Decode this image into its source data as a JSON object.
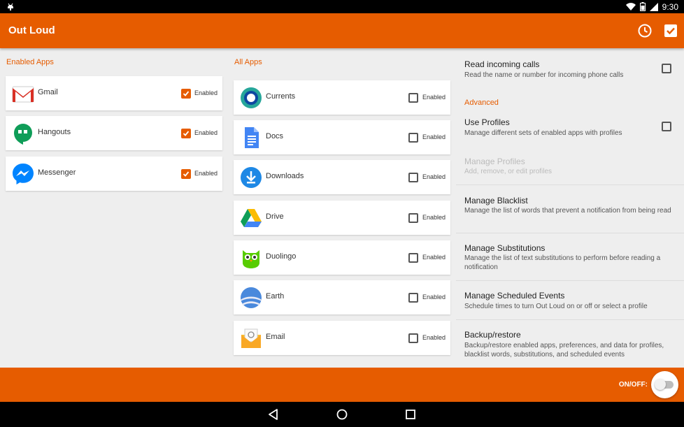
{
  "status_bar": {
    "time": "9:30"
  },
  "app_bar": {
    "title": "Out Loud"
  },
  "enabled_apps": {
    "header": "Enabled Apps",
    "items": [
      {
        "name": "Gmail",
        "enabled_label": "Enabled",
        "checked": true,
        "icon": "gmail-icon"
      },
      {
        "name": "Hangouts",
        "enabled_label": "Enabled",
        "checked": true,
        "icon": "hangouts-icon"
      },
      {
        "name": "Messenger",
        "enabled_label": "Enabled",
        "checked": true,
        "icon": "messenger-icon"
      }
    ]
  },
  "all_apps": {
    "header": "All Apps",
    "items": [
      {
        "name": "Currents",
        "enabled_label": "Enabled",
        "checked": false,
        "icon": "currents-icon"
      },
      {
        "name": "Docs",
        "enabled_label": "Enabled",
        "checked": false,
        "icon": "docs-icon"
      },
      {
        "name": "Downloads",
        "enabled_label": "Enabled",
        "checked": false,
        "icon": "downloads-icon"
      },
      {
        "name": "Drive",
        "enabled_label": "Enabled",
        "checked": false,
        "icon": "drive-icon"
      },
      {
        "name": "Duolingo",
        "enabled_label": "Enabled",
        "checked": false,
        "icon": "duolingo-icon"
      },
      {
        "name": "Earth",
        "enabled_label": "Enabled",
        "checked": false,
        "icon": "earth-icon"
      },
      {
        "name": "Email",
        "enabled_label": "Enabled",
        "checked": false,
        "icon": "email-icon"
      }
    ]
  },
  "settings": {
    "read_calls": {
      "title": "Read incoming calls",
      "summary": "Read the name or number for incoming phone calls",
      "checked": false
    },
    "advanced_header": "Advanced",
    "use_profiles": {
      "title": "Use Profiles",
      "summary": "Manage different sets of enabled apps with profiles",
      "checked": false
    },
    "manage_profiles": {
      "title": "Manage Profiles",
      "summary": "Add, remove, or edit profiles"
    },
    "manage_blacklist": {
      "title": "Manage Blacklist",
      "summary": "Manage the list of words that prevent a notification from being read"
    },
    "manage_substitutions": {
      "title": "Manage Substitutions",
      "summary": "Manage the list of text substitutions to perform before reading a notification"
    },
    "manage_scheduled": {
      "title": "Manage Scheduled Events",
      "summary": "Schedule times to turn Out Loud on or off or select a profile"
    },
    "backup_restore": {
      "title": "Backup/restore",
      "summary": "Backup/restore enabled apps, preferences, and data for profiles, blacklist words, substitutions, and scheduled events"
    }
  },
  "bottom_bar": {
    "onoff_label": "ON/OFF:",
    "switch_on": false
  },
  "colors": {
    "accent": "#e65c00",
    "background": "#eeeeee"
  }
}
